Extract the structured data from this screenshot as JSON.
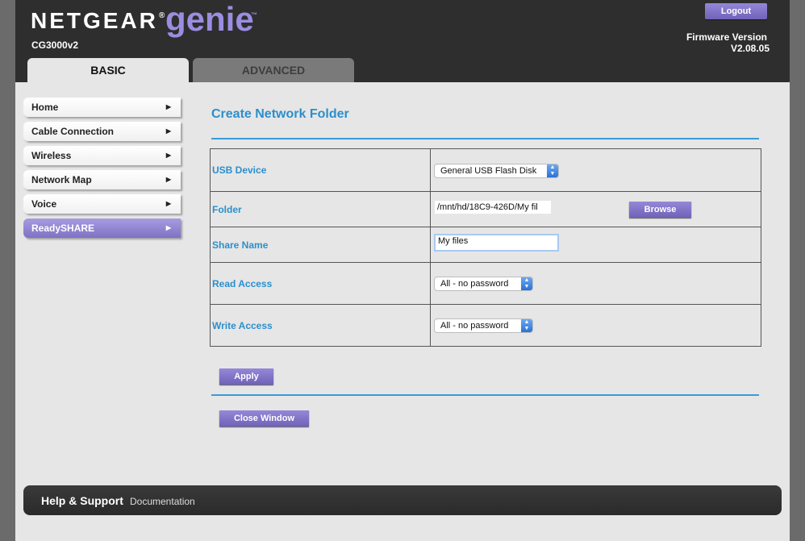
{
  "header": {
    "brand": "NETGEAR",
    "brand_reg": "®",
    "product": "genie",
    "product_tm": "™",
    "model": "CG3000v2",
    "logout_label": "Logout",
    "firmware_label": "Firmware Version",
    "firmware_value": "V2.08.05"
  },
  "tabs": [
    {
      "label": "BASIC",
      "active": true
    },
    {
      "label": "ADVANCED",
      "active": false
    }
  ],
  "sidebar": {
    "items": [
      {
        "label": "Home"
      },
      {
        "label": "Cable Connection"
      },
      {
        "label": "Wireless"
      },
      {
        "label": "Network Map"
      },
      {
        "label": "Voice"
      },
      {
        "label": "ReadySHARE",
        "active": true
      }
    ]
  },
  "main": {
    "title": "Create Network Folder",
    "form": {
      "usb_device_label": "USB Device",
      "usb_device_value": "General USB Flash Disk",
      "folder_label": "Folder",
      "folder_value": "/mnt/hd/18C9-426D/My fil",
      "browse_label": "Browse",
      "share_name_label": "Share Name",
      "share_name_value": "My files",
      "read_access_label": "Read Access",
      "read_access_value": "All - no password",
      "write_access_label": "Write Access",
      "write_access_value": "All - no password"
    },
    "apply_label": "Apply",
    "close_label": "Close Window"
  },
  "footer": {
    "help_title": "Help & Support",
    "documentation_label": "Documentation"
  },
  "colors": {
    "accent_purple": "#7f72c4",
    "title_blue": "#2b8fcc",
    "header_dark": "#2e2e2e"
  }
}
